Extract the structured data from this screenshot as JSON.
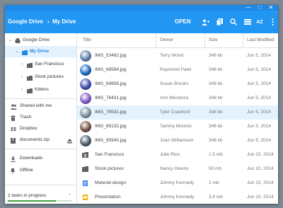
{
  "window": {
    "minimize": "—",
    "maximize": "□",
    "close": "✕"
  },
  "header": {
    "breadcrumb_root": "Google Drive",
    "breadcrumb_sep": "›",
    "breadcrumb_current": "My Drive",
    "open_label": "OPEN",
    "sort_label": "AZ"
  },
  "sidebar": {
    "google_drive": "Google Drive",
    "my_drive": "My Drive",
    "san_francisco": "San Francisco",
    "stock_pictures": "Stock pictures",
    "kittens": "Kittens",
    "shared_with_me": "Shared with me",
    "trash": "Trash",
    "dropbox": "Dropbox",
    "documents_zip": "documents.zip",
    "downloads": "Downloads",
    "offline": "Offline",
    "tasks_label": "2 tasks in progress",
    "tasks_progress": 0.75
  },
  "columns": {
    "title": "Title",
    "owner": "Owner",
    "size": "Size",
    "modified": "Last Modified"
  },
  "files": [
    {
      "name": "IMG_53462.jpg",
      "owner": "Terry Wood",
      "size": "348 kb",
      "date": "Jun 5, 2014",
      "kind": "image",
      "color": "#5d7fa8"
    },
    {
      "name": "IMG_68594.jpg",
      "owner": "Raymond Patel",
      "size": "348 kb",
      "date": "Jun 5, 2014",
      "kind": "image",
      "color": "#1565c0"
    },
    {
      "name": "IMG_69858.jpg",
      "owner": "Susan Brooks",
      "size": "348 kb",
      "date": "Jun 5, 2014",
      "kind": "image",
      "color": "#3949ab"
    },
    {
      "name": "IMG_76431.jpg",
      "owner": "Ann Mendoza",
      "size": "348 kb",
      "date": "Jun 5, 2014",
      "kind": "image",
      "color": "#7e57c2"
    },
    {
      "name": "IMG_78531.jpg",
      "owner": "Tyler Crawford",
      "size": "348 kb",
      "date": "Jun 5, 2014",
      "kind": "image",
      "color": "#78909c",
      "selected": true
    },
    {
      "name": "IMG_85132.jpg",
      "owner": "Tammy Moreno",
      "size": "348 kb",
      "date": "Jun 5, 2014",
      "kind": "image",
      "color": "#6d4c41"
    },
    {
      "name": "IMG_95940.jpg",
      "owner": "Joan Williamson",
      "size": "348 kb",
      "date": "Jun 5, 2014",
      "kind": "image",
      "color": "#455a64"
    },
    {
      "name": "San Francisco",
      "owner": "Julie Rios",
      "size": "1.5 mb",
      "date": "Jun 10, 2014",
      "kind": "shared-folder",
      "color": "#616161"
    },
    {
      "name": "Stock pictures",
      "owner": "Nancy Owens",
      "size": "50 mb",
      "date": "Jun 10, 2014",
      "kind": "folder",
      "color": "#616161"
    },
    {
      "name": "Material design",
      "owner": "Johnny Kennedy",
      "size": "1 mb",
      "date": "Jun 10, 2014",
      "kind": "doc",
      "color": "#4285f4"
    },
    {
      "name": "Presentation",
      "owner": "Johnny Kennedy",
      "size": "3.4 mb",
      "date": "Jun 10, 2014",
      "kind": "slides",
      "color": "#f4b400"
    }
  ]
}
